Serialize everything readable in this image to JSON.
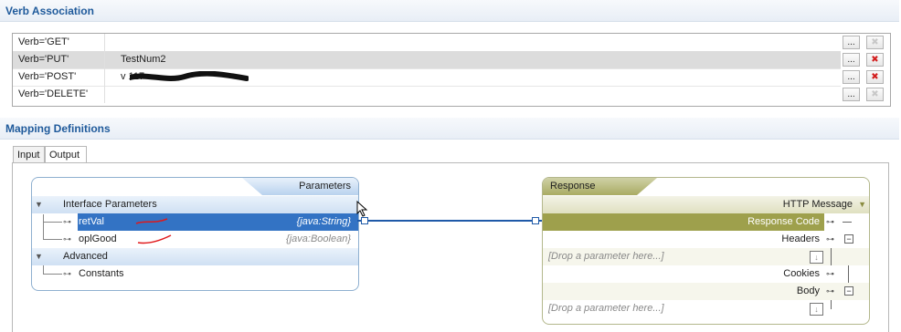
{
  "verb_section": {
    "title": "Verb Association",
    "rows": [
      {
        "verb": "Verb='GET'",
        "value": "",
        "more": "...",
        "delete": "✖"
      },
      {
        "verb": "Verb='PUT'",
        "value": "TestNum2",
        "more": "...",
        "delete": "✖"
      },
      {
        "verb": "Verb='POST'",
        "value": "v                              117",
        "more": "...",
        "delete": "✖"
      },
      {
        "verb": "Verb='DELETE'",
        "value": "",
        "more": "...",
        "delete": "✖"
      }
    ]
  },
  "mapping_section": {
    "title": "Mapping Definitions",
    "tabs": [
      "Input",
      "Output"
    ]
  },
  "parameters_panel": {
    "header": "Parameters",
    "group1": "Interface Parameters",
    "items": [
      {
        "name": "retVal",
        "type": "{java:String}"
      },
      {
        "name": "oplGood",
        "type": "{java:Boolean}"
      }
    ],
    "group2": "Advanced",
    "advanced_item": "Constants"
  },
  "response_panel": {
    "header": "Response",
    "subheader": "HTTP Message",
    "response_code": "Response Code",
    "headers": "Headers",
    "drop1": "[Drop a parameter here...]",
    "cookies": "Cookies",
    "body": "Body",
    "drop2": "[Drop a parameter here...]"
  },
  "colors": {
    "accent": "#3a78c2",
    "olive": "#9ea04c",
    "delete": "#d21e1e"
  }
}
